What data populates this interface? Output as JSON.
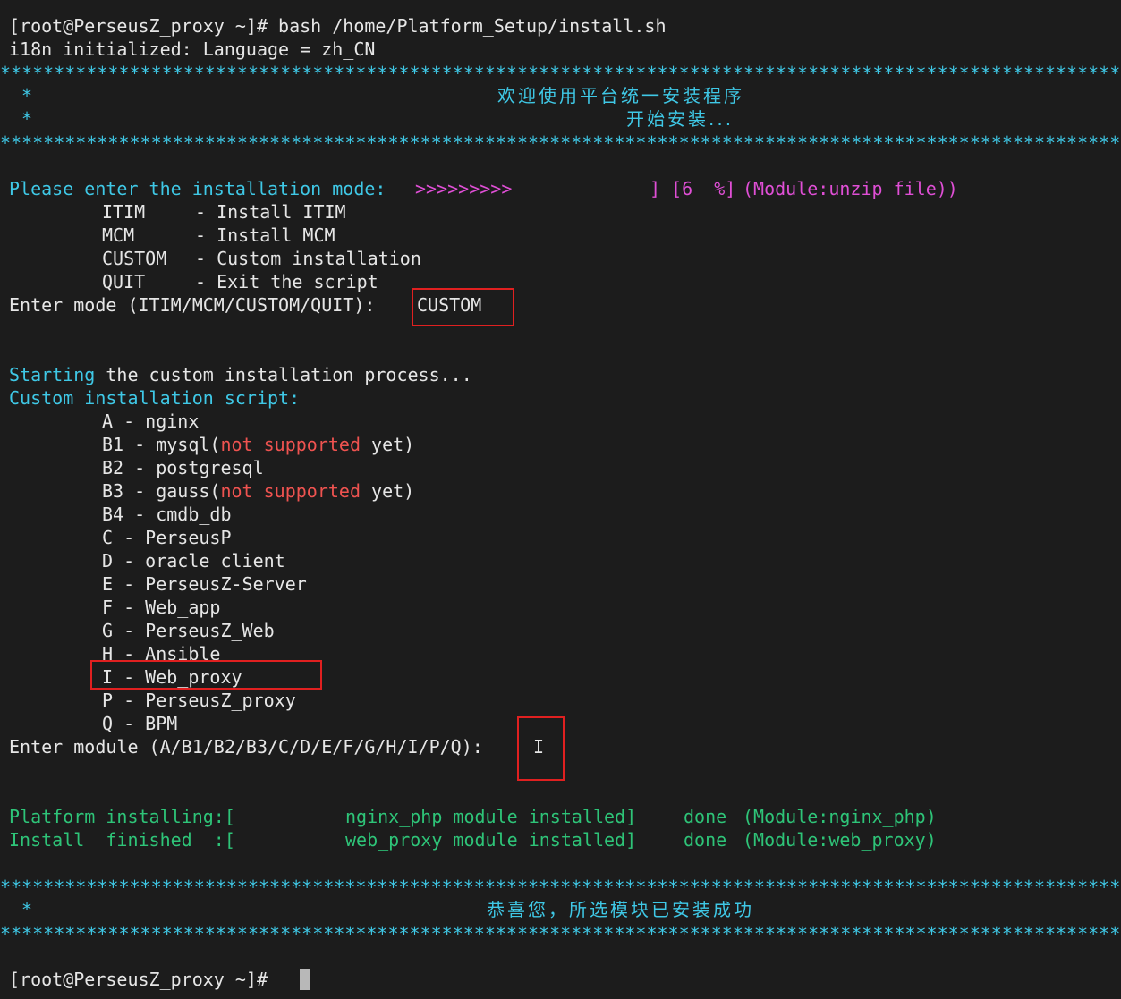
{
  "terminal": {
    "cmd_line": "[root@PerseusZ_proxy ~]# bash /home/Platform_Setup/install.sh",
    "i18n_line": "i18n initialized: Language = zh_CN",
    "stars_top": "****************************************************************************************************************************",
    "banner_star": "*",
    "banner_title": "欢迎使用平台统一安装程序",
    "banner_sub": "开始安装...",
    "prompt_label": "Please enter the installation mode:",
    "progress_arrows": ">>>>>>>>>",
    "progress_pct": "] [6  %]",
    "progress_module": "(Module:unzip_file))",
    "modes": [
      {
        "key": "ITIM",
        "desc": "- Install ITIM"
      },
      {
        "key": "MCM",
        "desc": "- Install MCM"
      },
      {
        "key": "CUSTOM",
        "desc": "- Custom installation"
      },
      {
        "key": "QUIT",
        "desc": "- Exit the script"
      }
    ],
    "enter_mode_label": "Enter mode (ITIM/MCM/CUSTOM/QUIT):",
    "enter_mode_value": "CUSTOM",
    "starting_word": "Starting",
    "starting_rest": " the custom installation process...",
    "custom_script_label": "Custom installation script:",
    "modules": {
      "A": "A - nginx",
      "B1_pre": "B1 - mysql(",
      "B1_warn": "not supported",
      "B1_post": " yet)",
      "B2": "B2 - postgresql",
      "B3_pre": "B3 - gauss(",
      "B3_warn": "not supported",
      "B3_post": " yet)",
      "B4": "B4 - cmdb_db",
      "C": "C - PerseusP",
      "D": "D - oracle_client",
      "E": "E - PerseusZ-Server",
      "F": "F - Web_app",
      "G": "G - PerseusZ_Web",
      "H": "H - Ansible",
      "I": "I - Web_proxy",
      "P": "P - PerseusZ_proxy",
      "Q": "Q - BPM"
    },
    "enter_module_label": "Enter module (A/B1/B2/B3/C/D/E/F/G/H/I/P/Q):",
    "enter_module_value": "I",
    "platform_label": "Platform installing:[",
    "platform_msg": "nginx_php module installed]",
    "platform_done": "done",
    "platform_module": "(Module:nginx_php)",
    "install_label": "Install  finished  :[",
    "install_msg": "web_proxy module installed]",
    "install_done": "done",
    "install_module": "(Module:web_proxy)",
    "success_text": "恭喜您，所选模块已安装成功",
    "final_prompt": "[root@PerseusZ_proxy ~]# "
  },
  "colors": {
    "background": "#1c1c1c",
    "cyan": "#3fc8e6",
    "magenta": "#e04fd6",
    "red": "#ef5350",
    "green": "#2ec478",
    "highlight_box": "#e02020"
  }
}
